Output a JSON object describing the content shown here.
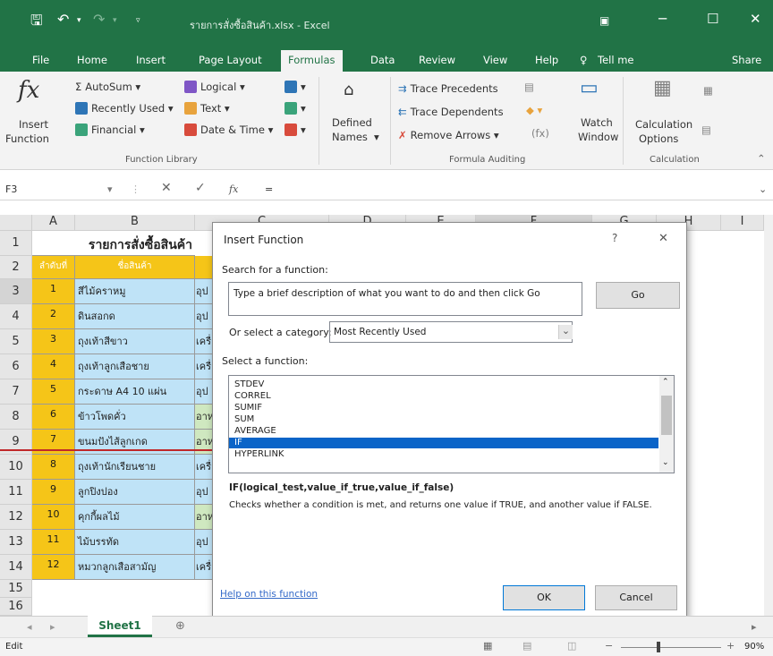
{
  "titlebar": {
    "document_title": "รายการสั่งซื้อสินค้า.xlsx  -  Excel",
    "save_icon": "save-icon",
    "undo_icon": "undo-icon",
    "redo_icon": "redo-icon",
    "customize_icon": "customize-qat-icon"
  },
  "tabs": [
    {
      "label": "File"
    },
    {
      "label": "Home"
    },
    {
      "label": "Insert"
    },
    {
      "label": "Page Layout"
    },
    {
      "label": "Formulas"
    },
    {
      "label": "Data"
    },
    {
      "label": "Review"
    },
    {
      "label": "View"
    },
    {
      "label": "Help"
    },
    {
      "label": "Tell me"
    },
    {
      "label": "Share"
    }
  ],
  "ribbon": {
    "insert_function": {
      "line1": "Insert",
      "line2": "Function"
    },
    "function_library": {
      "autosum": "AutoSum",
      "recently_used": "Recently Used",
      "financial": "Financial",
      "logical": "Logical",
      "text": "Text",
      "date_time": "Date & Time",
      "label": "Function Library"
    },
    "defined_names": {
      "line1": "Defined",
      "line2": "Names"
    },
    "formula_auditing": {
      "trace_precedents": "Trace Precedents",
      "trace_dependents": "Trace Dependents",
      "remove_arrows": "Remove Arrows",
      "label": "Formula Auditing"
    },
    "watch_window": {
      "line1": "Watch",
      "line2": "Window"
    },
    "calculation": {
      "line1": "Calculation",
      "line2": "Options",
      "label": "Calculation"
    }
  },
  "formula_bar": {
    "name_box": "F3",
    "fx": "fx",
    "content": "="
  },
  "columns": [
    "A",
    "B",
    "C",
    "D",
    "E",
    "F",
    "G",
    "H",
    "I"
  ],
  "rows": [
    "1",
    "2",
    "3",
    "4",
    "5",
    "6",
    "7",
    "8",
    "9",
    "10",
    "11",
    "12",
    "13",
    "14",
    "15",
    "16"
  ],
  "sheet": {
    "title_cell": "รายการสั่งซื้อสินค้า",
    "header_a": "ลำดับที่",
    "header_b": "ชื่อสินค้า",
    "items": [
      {
        "no": "1",
        "name": "สีไม้คราหมู",
        "c": "อุป"
      },
      {
        "no": "2",
        "name": "ดินสอกด",
        "c": "อุป"
      },
      {
        "no": "3",
        "name": "ถุงเท้าสีขาว",
        "c": "เครื่"
      },
      {
        "no": "4",
        "name": "ถุงเท้าลูกเสือชาย",
        "c": "เครื่"
      },
      {
        "no": "5",
        "name": "กระดาษ A4 10 แผ่น",
        "c": "อุป"
      },
      {
        "no": "6",
        "name": "ข้าวโพดคั่ว",
        "c": "อาห"
      },
      {
        "no": "7",
        "name": "ขนมปังไส้ลูกเกด",
        "c": "อาห"
      },
      {
        "no": "8",
        "name": "ถุงเท้านักเรียนชาย",
        "c": "เครื่"
      },
      {
        "no": "9",
        "name": "ลูกปิงปอง",
        "c": "อุป"
      },
      {
        "no": "10",
        "name": "คุกกี้ผลไม้",
        "c": "อาห"
      },
      {
        "no": "11",
        "name": "ไม้บรรทัด",
        "c": "อุป"
      },
      {
        "no": "12",
        "name": "หมวกลูกเสือสามัญ",
        "c": "เครื่"
      }
    ]
  },
  "dialog": {
    "title": "Insert Function",
    "help_glyph": "?",
    "close_glyph": "✕",
    "search_label": "Search for a function:",
    "search_value": "Type a brief description of what you want to do and then click Go",
    "go_button": "Go",
    "category_label": "Or select a category:",
    "category_value": "Most Recently Used",
    "select_label": "Select a function:",
    "functions": [
      "STDEV",
      "CORREL",
      "SUMIF",
      "SUM",
      "AVERAGE",
      "IF",
      "HYPERLINK"
    ],
    "selected_function": "IF",
    "signature": "IF(logical_test,value_if_true,value_if_false)",
    "description": "Checks whether a condition is met, and returns one value if TRUE, and another value if FALSE.",
    "help_link": "Help on this function",
    "ok_button": "OK",
    "cancel_button": "Cancel"
  },
  "sheet_tabs": [
    {
      "label": "Sheet1"
    }
  ],
  "add_sheet": "⊕",
  "status": {
    "mode": "Edit",
    "zoom": "90%",
    "zoom_minus": "−",
    "zoom_plus": "+"
  },
  "colors": {
    "excel_green": "#217346",
    "selection_blue": "#0a64c8",
    "header_yellow": "#f5c518",
    "annotation_red": "#c0282a",
    "data_blue": "#bfe3f7",
    "data_green": "#cfe8c0"
  }
}
